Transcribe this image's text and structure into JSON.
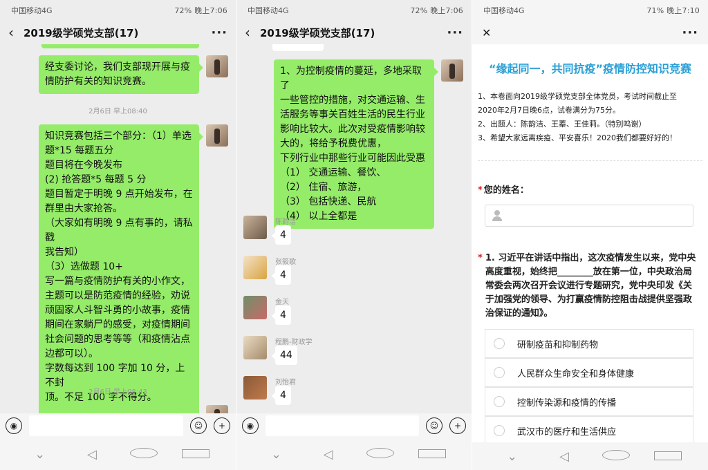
{
  "status_bar": {
    "p1": {
      "carrier": "中国移动4G",
      "right": "72% 晚上7:06"
    },
    "p2": {
      "carrier": "中国移动4G",
      "right": "72% 晚上7:06"
    },
    "p3": {
      "carrier": "中国移动4G",
      "right": "71% 晚上7:10"
    }
  },
  "chat": {
    "title": "2019级学硕党支部(17)",
    "more": "···"
  },
  "panel1": {
    "msg1": "经支委讨论，我们支部现开展与疫情防护有关的知识竞赛。",
    "time1": "2月6日 早上08:40",
    "msg2_lines": [
      "知识竞赛包括三个部分：（1）单选",
      "题*15 每题五分",
      "题目将在今晚发布",
      "(2) 抢答题*5 每题 5 分",
      "题目暂定于明晚 9 点开始发布，在",
      "群里由大家抢答。",
      "（大家如有明晚 9 点有事的，请私戳",
      "我告知）",
      "（3）选做题 10+",
      "写一篇与疫情防护有关的小作文，",
      "主题可以是防范疫情的经验，劝说",
      "顽固家人斗智斗勇的小故事，疫情",
      "期间在家躺尸的感受，对疫情期间",
      "社会问题的思考等等（和疫情沾点",
      "边都可以）。",
      "字数每达到 100 字加 10 分，上不封",
      "顶。不足 100 字不得分。"
    ],
    "time2": "2月6日 早上08:43"
  },
  "panel2": {
    "msg_lines": [
      "1、为控制疫情的蔓延，多地采取了",
      "一些管控的措施，对交通运输、生",
      "活服务等事关百姓生活的民生行业",
      "影响比较大。此次对受疫情影响较",
      "大的，将给予税费优惠，",
      "下列行业中那些行业可能因此受惠",
      "（1）  交通运输、餐饮、",
      "（2）  住宿、旅游，",
      "（3）   包括快递、民航",
      "（4）   以上全都是"
    ],
    "replies": [
      {
        "name": "陈韵洁",
        "text": "4"
      },
      {
        "name": "张筱歌",
        "text": "4"
      },
      {
        "name": "金天",
        "text": "4"
      },
      {
        "name": "程鹏-财政学",
        "text": "44"
      },
      {
        "name": "刘怡君",
        "text": "4"
      }
    ]
  },
  "form": {
    "close": "✕",
    "more": "···",
    "title": "“缘起同一，共同抗疫”疫情防控知识竞赛",
    "notes": [
      "1、本卷面向2019级学硕党支部全体党员，考试时间截止至",
      "2020年2月7日晚6点，试卷满分为75分。",
      "2、出题人：陈韵洁、王蓁、王佳莉。（特别鸣谢）",
      "3、希望大家远离疾疫、平安喜乐！2020我们都要好好的！"
    ],
    "name_label": "您的姓名：",
    "required_mark": "*",
    "q1": "1. 习近平在讲话中指出，这次疫情发生以来，党中央高度重视，始终把________放在第一位，中央政治局常委会两次召开会议进行专题研究，党中央印发《关于加强党的领导、为打赢疫情防控阻击战提供坚强政治保证的通知》。",
    "options": [
      "研制疫苗和抑制药物",
      "人民群众生命安全和身体健康",
      "控制传染源和疫情的传播",
      "武汉市的医疗和生活供应"
    ]
  }
}
